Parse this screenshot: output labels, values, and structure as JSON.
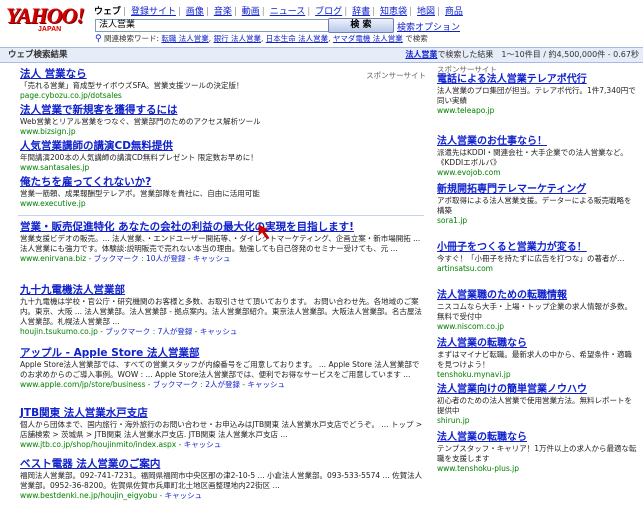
{
  "header": {
    "logo_text": "YAHOO!",
    "logo_sub": "JAPAN",
    "nav": [
      "ウェブ",
      "登録サイト",
      "画像",
      "音楽",
      "動画",
      "ニュース",
      "ブログ",
      "辞書",
      "知恵袋",
      "地図",
      "商品"
    ],
    "search_value": "法人営業",
    "search_button": "検 索",
    "search_options": "検索オプション",
    "related_prefix": "関連検索ワード:",
    "related": [
      "転職 法人営業",
      "銀行 法人営業",
      "日本生命 法人営業",
      "ヤマダ電機 法人営業"
    ],
    "related_suffix": "で検索"
  },
  "bar": {
    "left": "ウェブ検索結果",
    "keyword": "法人営業",
    "right": "で検索した結果　1〜10件目 / 約4,500,000件 - 0.67秒"
  },
  "sponsor_label": "スポンサーサイト",
  "results": [
    {
      "title": "法人 営業なら",
      "snippet": "「売れる営業」育成型サイボウズSFA。営業支援ツールの決定版！",
      "url": "page.cybozu.co.jp/dotsales"
    },
    {
      "title": "法人営業で新規客を獲得するには",
      "snippet": "Web営業とリアル営業をつなぐ、営業部門のためのアクセス解析ツール",
      "url": "www.bizsign.jp"
    },
    {
      "title": "人気営業講師の講演CD無料提供",
      "snippet": "年間講演200本の人気講師の講演CD無料プレゼント 限定数お早めに！",
      "url": "www.santasales.jp"
    },
    {
      "title": "俺たちを雇ってくれないか?",
      "snippet": "営業一筋頼、成果報酬型テレアポ。営業部隊を貴社に、自由に活用可能",
      "url": "www.executive.jp"
    },
    {
      "title": "営業・販売促進特化 あなたの会社の利益の最大化の実現を目指します!",
      "snippet": "営業支援ビデオの販売。... 法人営業、・エンドユーザー開拓等、・ダイレクトマーケティング、企画立案・新市場開拓 ... 法人営業にも強力です。体験談:説明販売で売れない本当の理由。勉強しても自己啓発のセミナー受けても、元 ...",
      "url": "www.enirvana.biz",
      "extras": [
        "ブックマーク",
        "10人が登録",
        "キャッシュ"
      ]
    },
    {
      "title": "九十九電機法人営業部",
      "snippet": "九十九電機は学校・官公庁・研究機関のお客様と多数、お取引させて頂いております。 お問い合わせ先。各地域のご案内。東京、大阪 ... 法人営業部。法人営業部 - 拠点案内。法人営業部紹介。東京法人営業部。大阪法人営業部。名古屋法人営業部。札幌法人営業部 ...",
      "url": "houjin.tsukumo.co.jp",
      "extras": [
        "ブックマーク",
        "7人が登録",
        "キャッシュ"
      ]
    },
    {
      "title": "アップル - Apple Store 法人営業部",
      "snippet": "Apple Store法人営業部では、すべての営業スタッフが内線番号をご用意しております。 ... Apple Store 法人営業部でのお求めからのご導入事例。WOW : ... Apple Store法人営業部では、便利でお得なサービスをご用意しています ...",
      "url": "www.apple.com/jp/store/business",
      "extras": [
        "ブックマーク",
        "2人が登録",
        "キャッシュ"
      ]
    },
    {
      "title": "JTB関東 法人営業水戸支店",
      "snippet": "個人から団体まで、国内旅行・海外旅行のお問い合わせ・お申込みはJTB関東 法人営業水戸支店でどうぞ。 ... トップ > 店舗検索 > 茨城県 > JTB関東 法人営業水戸支店. JTB関東 法人営業水戸支店 ...",
      "url": "www.jtb.co.jp/shop/houjinmito/index.aspx",
      "extras": [
        "キャッシュ"
      ]
    },
    {
      "title": "ベスト電器 法人営業のご案内",
      "snippet": "福岡法人営業部。092-741-7231。福岡県福岡市中央区那の津2-10-5 ... 小倉法人営業部。093-533-5574 ... 佐賀法人営業部。0952-36-8200。佐賀県佐賀市兵庫町北土地区画整理地内22街区 ...",
      "url": "www.bestdenki.ne.jp/houjin_eigyobu",
      "extras": [
        "キャッシュ"
      ]
    }
  ],
  "side": {
    "label": "スポンサーサイト",
    "ads": [
      {
        "title": "電話による法人営業テレアポ代行",
        "desc": "法人営業のプロ集団が担当。テレアポ代行。1件7,340円で同い実績",
        "url": "www.teleapo.jp"
      },
      {
        "title": "法人営業のお仕事なら！",
        "desc": "派遣先はKDDI・関連会社・大手企業での法人営業など。《KDDIエボルバ》",
        "url": "www.evojob.com"
      },
      {
        "title": "新規開拓専門テレマーケティング",
        "desc": "アポ取得による法人営業支援。データーによる販売戦略を構築",
        "url": "sora1.jp"
      },
      {
        "title": "小冊子をつくると営業力が変る！",
        "desc": "今すぐ！「小冊子を持たずに広告を打つな」の著者が…",
        "url": "artinsatsu.com"
      },
      {
        "title": "法人営業職のための転職情報",
        "desc": "ニスコムなら大手・上場・トップ企業の求人情報が多数。無料で受付中",
        "url": "www.niscom.co.jp"
      },
      {
        "title": "法人営業の転職なら",
        "desc": "まずはマイナビ転職。最新求人の中から、希望条件・適職を見つけよう！",
        "url": "tenshoku.mynavi.jp"
      },
      {
        "title": "法人営業向けの簡単営業ノウハウ",
        "desc": "初心者のための法人営業で使用営業方法。無料レポートを提供中",
        "url": "shirun.jp"
      },
      {
        "title": "法人営業の転職なら",
        "desc": "テンプスタッフ・キャリア！1万件以上の求人から最適な転職を支援します",
        "url": "www.tenshoku-plus.jp"
      }
    ]
  },
  "colors": {
    "link": "#1122cc",
    "url": "#008000",
    "logo": "#d40000",
    "bar": "#e7edf8"
  }
}
